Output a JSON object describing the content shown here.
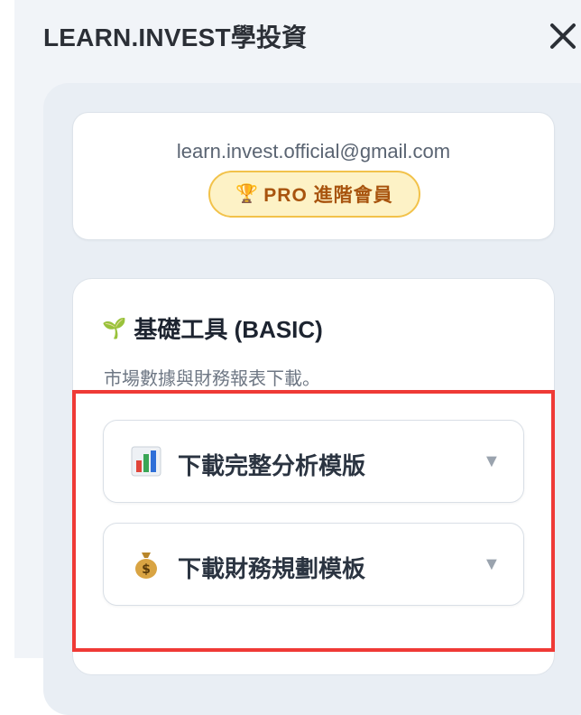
{
  "header": {
    "title": "LEARN.INVEST學投資",
    "close_icon": "close-icon"
  },
  "account": {
    "email": "learn.invest.official@gmail.com",
    "badge_icon": "🏆",
    "badge_label": "PRO 進階會員"
  },
  "basic": {
    "icon": "🌱",
    "title": "基礎工具 (BASIC)",
    "description": "市場數據與財務報表下載。",
    "items": [
      {
        "icon": "bar-chart-icon",
        "label": "下載完整分析模版",
        "caret": "▼"
      },
      {
        "icon": "money-bag-icon",
        "label": "下載財務規劃模板",
        "caret": "▼"
      }
    ]
  },
  "colors": {
    "highlight": "#ef3a36",
    "badge_bg": "#fdf2c6",
    "badge_border": "#f2c24a",
    "badge_text": "#a8540e"
  }
}
